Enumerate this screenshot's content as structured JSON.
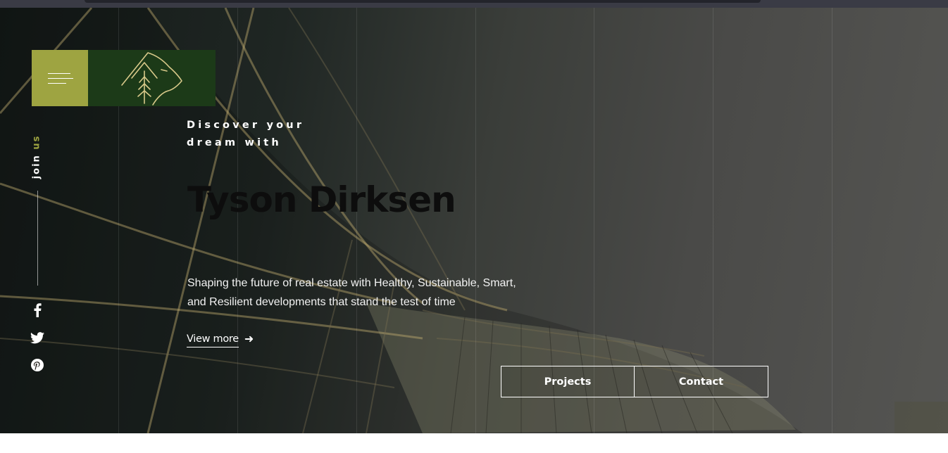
{
  "hero": {
    "eyebrow_line1": "Discover your",
    "eyebrow_line2": "dream with",
    "title": "Tyson Dirksen",
    "description": "Shaping the future of real estate with Healthy, Sustainable, Smart, and Resilient developments that stand the test of time",
    "view_more_label": "View more",
    "view_more_arrow": "➜"
  },
  "sidebar": {
    "join_word": "join",
    "us_word": "us",
    "social_icons": [
      "facebook-icon",
      "twitter-icon",
      "pinterest-icon"
    ]
  },
  "buttons": {
    "projects": "Projects",
    "contact": "Contact"
  },
  "colors": {
    "accent": "#9ea441",
    "brand_dark": "#1c3a18",
    "logo_line": "#d8c98a"
  }
}
